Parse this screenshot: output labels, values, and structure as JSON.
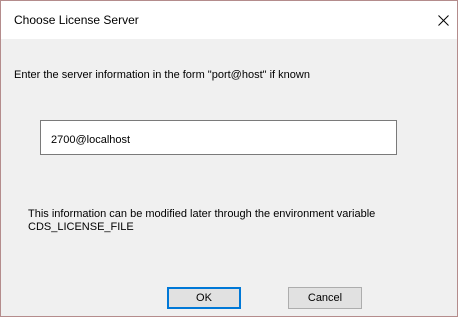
{
  "window": {
    "title": "Choose License Server",
    "close_icon": "close-icon"
  },
  "form": {
    "instruction": "Enter the server information in the form \"port@host\" if known",
    "server_value": "2700@localhost",
    "info_line1": "This information can be modified later through the environment variable",
    "info_line2": "CDS_LICENSE_FILE"
  },
  "buttons": {
    "ok_label": "OK",
    "cancel_label": "Cancel"
  },
  "colors": {
    "dialog_background": "#f0f0f0",
    "titlebar_background": "#ffffff",
    "border": "#b48c8c",
    "default_button_accent": "#0078d7"
  }
}
